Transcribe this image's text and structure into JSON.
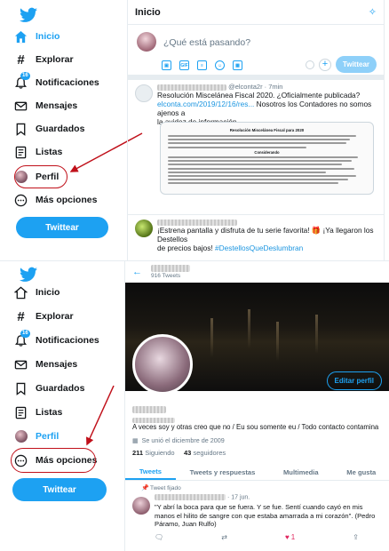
{
  "nav": {
    "home": "Inicio",
    "explore": "Explorar",
    "notifications": "Notificaciones",
    "notifications_badge_top": "16",
    "notifications_badge_bottom": "16",
    "messages": "Mensajes",
    "bookmarks": "Guardados",
    "lists": "Listas",
    "profile": "Perfil",
    "more": "Más opciones",
    "tweet_button": "Twittear"
  },
  "home": {
    "title": "Inicio",
    "compose_placeholder": "¿Qué está pasando?",
    "compose_button": "Twittear",
    "tweet1": {
      "handle_time": "@elconta2r · 7min",
      "line1": "Resolución Miscelánea Fiscal 2020. ¿Oficialmente publicada?",
      "link": "elconta.com/2019/12/16/res...",
      "line2": " Nosotros los Contadores no somos ajenos a",
      "line3": "la avidez de información..",
      "doc_title": "Resolución Miscelánea Fiscal para 2020",
      "doc_subtitle": "Considerando"
    },
    "tweet2": {
      "line1": "¡Estrena pantalla y disfruta de tu serie favorita! 🎁 ¡Ya llegaron los Destellos",
      "line2_prefix": "de precios bajos! ",
      "hashtag": "#DestellosQueDeslumbran"
    }
  },
  "profile": {
    "tweet_count": "916 Tweets",
    "edit_button": "Editar perfil",
    "bio": "A veces soy y otras creo que no / Eu sou somente eu / Todo contacto contamina",
    "joined": "Se unió el diciembre de 2009",
    "following_count": "211",
    "following_label": "Siguiendo",
    "followers_count": "43",
    "followers_label": "seguidores",
    "tabs": [
      "Tweets",
      "Tweets y respuestas",
      "Multimedia",
      "Me gusta"
    ],
    "pinned_label": "Tweet fijado",
    "pinned_date": "· 17 jun.",
    "pinned_text": "\"Y abrí la boca para que se fuera. Y se fue. Sentí cuando cayó en mis manos el hilito de sangre con que estaba amarrada a mi corazón\". (Pedro Páramo, Juan Rulfo)",
    "likes_count": "1"
  },
  "colors": {
    "accent": "#1da1f2",
    "annotation": "#c0101a"
  },
  "icons": [
    "twitter-bird-icon",
    "home-icon",
    "hashtag-icon",
    "bell-icon",
    "mail-icon",
    "bookmark-icon",
    "list-icon",
    "more-circle-icon",
    "sparkle-icon",
    "image-icon",
    "gif-icon",
    "poll-icon",
    "emoji-icon",
    "calendar-icon",
    "reply-icon",
    "retweet-icon",
    "heart-icon",
    "share-icon"
  ]
}
